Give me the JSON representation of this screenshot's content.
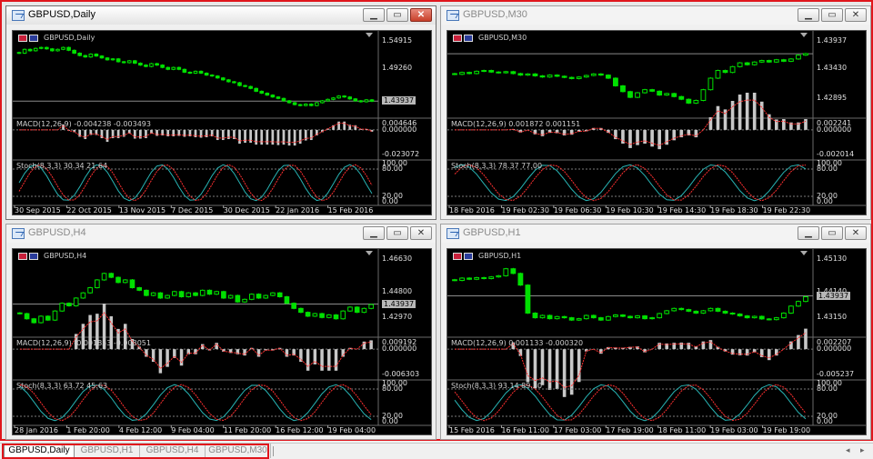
{
  "windows": [
    {
      "key": "daily",
      "title": "GBPUSD,Daily",
      "chart_label": "GBPUSD,Daily",
      "price_axis": [
        "1.54915",
        "1.49260",
        "1.43937"
      ],
      "current_price": "1.43937",
      "macd_label": "MACD(12,26,9) -0.004238 -0.003493",
      "macd_axis": [
        "0.004646",
        "0.000000",
        "-0.023072"
      ],
      "stoch_label": "Stoch(8,3,3) 30.34 21.64",
      "stoch_axis": [
        "100.00",
        "80.00",
        "20.00",
        "0.00"
      ],
      "time_axis": [
        "30 Sep 2015",
        "22 Oct 2015",
        "13 Nov 2015",
        "7 Dec 2015",
        "30 Dec 2015",
        "22 Jan 2016",
        "15 Feb 2016"
      ],
      "chart_data": {
        "type": "candlestick",
        "ylim": [
          1.415,
          1.56
        ],
        "close": [
          1.54,
          1.548,
          1.545,
          1.55,
          1.552,
          1.549,
          1.545,
          1.548,
          1.552,
          1.546,
          1.54,
          1.535,
          1.532,
          1.538,
          1.534,
          1.53,
          1.526,
          1.528,
          1.522,
          1.52,
          1.524,
          1.519,
          1.515,
          1.512,
          1.518,
          1.515,
          1.51,
          1.506,
          1.51,
          1.506,
          1.5,
          1.498,
          1.502,
          1.498,
          1.494,
          1.492,
          1.488,
          1.484,
          1.48,
          1.478,
          1.472,
          1.47,
          1.466,
          1.46,
          1.456,
          1.452,
          1.448,
          1.445,
          1.44,
          1.436,
          1.432,
          1.43,
          1.433,
          1.43,
          1.436,
          1.44,
          1.443,
          1.446,
          1.45,
          1.448,
          1.444,
          1.44,
          1.438,
          1.442,
          1.439
        ]
      }
    },
    {
      "key": "m30",
      "title": "GBPUSD,M30",
      "chart_label": "GBPUSD,M30",
      "price_axis": [
        "1.43937",
        "1.43430",
        "1.42895"
      ],
      "current_price": "1.43937",
      "macd_label": "MACD(12,26,9) 0.001872 0.001151",
      "macd_axis": [
        "0.002241",
        "0.000000",
        "-0.002014"
      ],
      "stoch_label": "Stoch(8,3,3) 78.37 77.00",
      "stoch_axis": [
        "100.00",
        "80.00",
        "20.00",
        "0.00"
      ],
      "time_axis": [
        "18 Feb 2016",
        "19 Feb 02:30",
        "19 Feb 06:30",
        "19 Feb 10:30",
        "19 Feb 14:30",
        "19 Feb 18:30",
        "19 Feb 22:30"
      ],
      "chart_data": {
        "type": "candlestick",
        "ylim": [
          1.424,
          1.442
        ],
        "close": [
          1.434,
          1.4345,
          1.4342,
          1.4348,
          1.435,
          1.4346,
          1.4344,
          1.4347,
          1.4342,
          1.4338,
          1.4341,
          1.4336,
          1.4333,
          1.4338,
          1.4335,
          1.4332,
          1.4329,
          1.4333,
          1.4337,
          1.4341,
          1.4338,
          1.433,
          1.431,
          1.4295,
          1.428,
          1.4292,
          1.43,
          1.4296,
          1.4286,
          1.429,
          1.4282,
          1.4275,
          1.4265,
          1.4272,
          1.43,
          1.433,
          1.435,
          1.4345,
          1.436,
          1.437,
          1.4365,
          1.4372,
          1.4376,
          1.4372,
          1.4378,
          1.4374,
          1.438,
          1.439,
          1.4394
        ]
      }
    },
    {
      "key": "h4",
      "title": "GBPUSD,H4",
      "chart_label": "GBPUSD,H4",
      "price_axis": [
        "1.46630",
        "1.44800",
        "1.43937",
        "1.42970"
      ],
      "current_price": "1.43937",
      "macd_label": "MACD(12,26,9) -0.001853 -0.003051",
      "macd_axis": [
        "0.009192",
        "0.000000",
        "-0.006303"
      ],
      "stoch_label": "Stoch(8,3,3) 63.72 45.63",
      "stoch_axis": [
        "100.00",
        "80.00",
        "20.00",
        "0.00"
      ],
      "time_axis": [
        "28 Jan 2016",
        "1 Feb 20:00",
        "4 Feb 12:00",
        "9 Feb 04:00",
        "11 Feb 20:00",
        "16 Feb 12:00",
        "19 Feb 04:00"
      ],
      "chart_data": {
        "type": "candlestick",
        "ylim": [
          1.418,
          1.472
        ],
        "close": [
          1.432,
          1.428,
          1.425,
          1.43,
          1.427,
          1.434,
          1.44,
          1.438,
          1.444,
          1.448,
          1.452,
          1.458,
          1.463,
          1.46,
          1.456,
          1.458,
          1.452,
          1.45,
          1.446,
          1.448,
          1.444,
          1.446,
          1.449,
          1.445,
          1.448,
          1.446,
          1.45,
          1.447,
          1.449,
          1.444,
          1.446,
          1.441,
          1.443,
          1.447,
          1.444,
          1.446,
          1.448,
          1.445,
          1.44,
          1.436,
          1.433,
          1.43,
          1.432,
          1.429,
          1.431,
          1.428,
          1.434,
          1.437,
          1.433,
          1.436,
          1.439
        ]
      }
    },
    {
      "key": "h1",
      "title": "GBPUSD,H1",
      "chart_label": "GBPUSD,H1",
      "price_axis": [
        "1.45130",
        "1.44140",
        "1.43937",
        "1.43150"
      ],
      "current_price": "1.43937",
      "macd_label": "MACD(12,26,9) 0.001133 -0.000320",
      "macd_axis": [
        "0.002207",
        "0.000000",
        "-0.005237"
      ],
      "stoch_label": "Stoch(8,3,3) 93.14 89.30",
      "stoch_axis": [
        "100.00",
        "80.00",
        "20.00",
        "0.00"
      ],
      "time_axis": [
        "15 Feb 2016",
        "16 Feb 11:00",
        "17 Feb 03:00",
        "17 Feb 19:00",
        "18 Feb 11:00",
        "19 Feb 03:00",
        "19 Feb 19:00"
      ],
      "chart_data": {
        "type": "candlestick",
        "ylim": [
          1.424,
          1.454
        ],
        "close": [
          1.446,
          1.447,
          1.4465,
          1.4472,
          1.4468,
          1.4475,
          1.448,
          1.451,
          1.449,
          1.444,
          1.432,
          1.43,
          1.431,
          1.4296,
          1.4305,
          1.43,
          1.429,
          1.4296,
          1.431,
          1.43,
          1.429,
          1.4305,
          1.4312,
          1.4306,
          1.43,
          1.4308,
          1.4296,
          1.43,
          1.4318,
          1.433,
          1.434,
          1.4335,
          1.4328,
          1.432,
          1.433,
          1.434,
          1.4328,
          1.432,
          1.4316,
          1.4308,
          1.43,
          1.4306,
          1.4295,
          1.4292,
          1.43,
          1.432,
          1.435,
          1.437,
          1.439
        ]
      }
    }
  ],
  "tabs": [
    "GBPUSD,Daily",
    "GBPUSD,H1",
    "GBPUSD,H4",
    "GBPUSD,M30"
  ],
  "active_tab": "GBPUSD,Daily",
  "colors": {
    "bull": "#00e000",
    "bear": "#00e000",
    "macd_hist": "#c8c8c8",
    "signal": "#ff3030",
    "stoch_main": "#28b4b4",
    "stoch_signal": "#ff3030",
    "grid": "#7a7a7a",
    "highlight": "#e0161c"
  }
}
